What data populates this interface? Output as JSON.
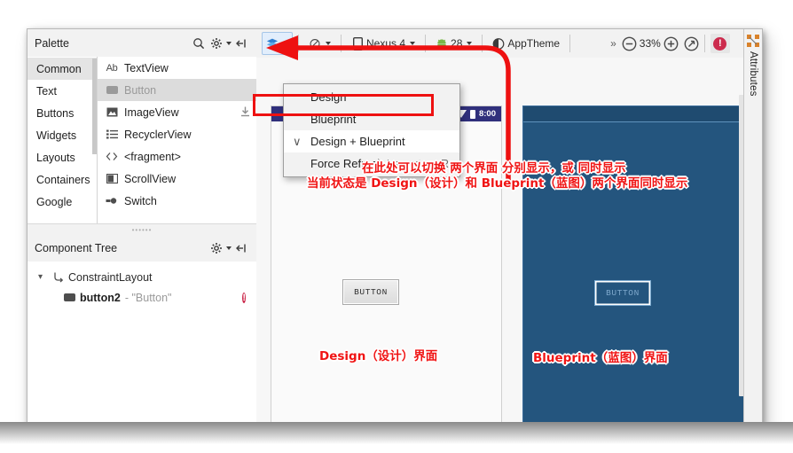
{
  "palette": {
    "title": "Palette",
    "icons": [
      "search-icon",
      "gear-icon",
      "collapse-icon"
    ],
    "categories": [
      {
        "label": "Common",
        "selected": true
      },
      {
        "label": "Text",
        "selected": false
      },
      {
        "label": "Buttons",
        "selected": false
      },
      {
        "label": "Widgets",
        "selected": false
      },
      {
        "label": "Layouts",
        "selected": false
      },
      {
        "label": "Containers",
        "selected": false
      },
      {
        "label": "Google",
        "selected": false
      }
    ],
    "items": [
      {
        "label": "TextView",
        "icon": "text-icon",
        "selected": false
      },
      {
        "label": "Button",
        "icon": "button-icon",
        "selected": true
      },
      {
        "label": "ImageView",
        "icon": "image-icon",
        "selected": false
      },
      {
        "label": "RecyclerView",
        "icon": "list-icon",
        "selected": false
      },
      {
        "label": "<fragment>",
        "icon": "code-icon",
        "selected": false
      },
      {
        "label": "ScrollView",
        "icon": "scroll-icon",
        "selected": false
      },
      {
        "label": "Switch",
        "icon": "switch-icon",
        "selected": false
      }
    ]
  },
  "component_tree": {
    "title": "Component Tree",
    "nodes": [
      {
        "name": "ConstraintLayout",
        "value": "",
        "icon": "constraint-layout-icon",
        "expanded": true,
        "error": false
      },
      {
        "name": "button2",
        "value": "- \"Button\"",
        "icon": "button-icon",
        "error": true
      }
    ]
  },
  "toolbar": {
    "layout_mode_icon": "layers-icon",
    "orientation_icon": "orientation-icon",
    "device": "Nexus 4",
    "api_level": "28",
    "theme": "AppTheme",
    "overflow": "»",
    "zoom_out_icon": "zoom-out-icon",
    "zoom_level": "33%",
    "zoom_in_icon": "zoom-in-icon",
    "zoom_fit_icon": "zoom-fit-icon",
    "error_badge": "!"
  },
  "menu": {
    "items": [
      {
        "label": "Design",
        "checked": false,
        "shortcut": ""
      },
      {
        "label": "Blueprint",
        "checked": false,
        "shortcut": ""
      },
      {
        "label": "Design + Blueprint",
        "checked": true,
        "shortcut": ""
      },
      {
        "label": "Force Refresh Layout",
        "checked": false,
        "shortcut": "R"
      }
    ],
    "check_glyph": "∨"
  },
  "design_preview": {
    "status_time": "8:00",
    "button_label": "BUTTON"
  },
  "blueprint_preview": {
    "button_label": "BUTTON"
  },
  "attributes_panel": {
    "label": "Attributes",
    "icon": "expand-icon"
  },
  "annotations": {
    "line1": "在此处可以切换 两个界面 分别显示，或 同时显示",
    "line2": "当前状态是 Design（设计）和 Blueprint（蓝图）两个界面同时显示",
    "design_label": "Design（设计）界面",
    "blueprint_label": "Blueprint（蓝图）界面",
    "accent_color": "#f01414"
  }
}
